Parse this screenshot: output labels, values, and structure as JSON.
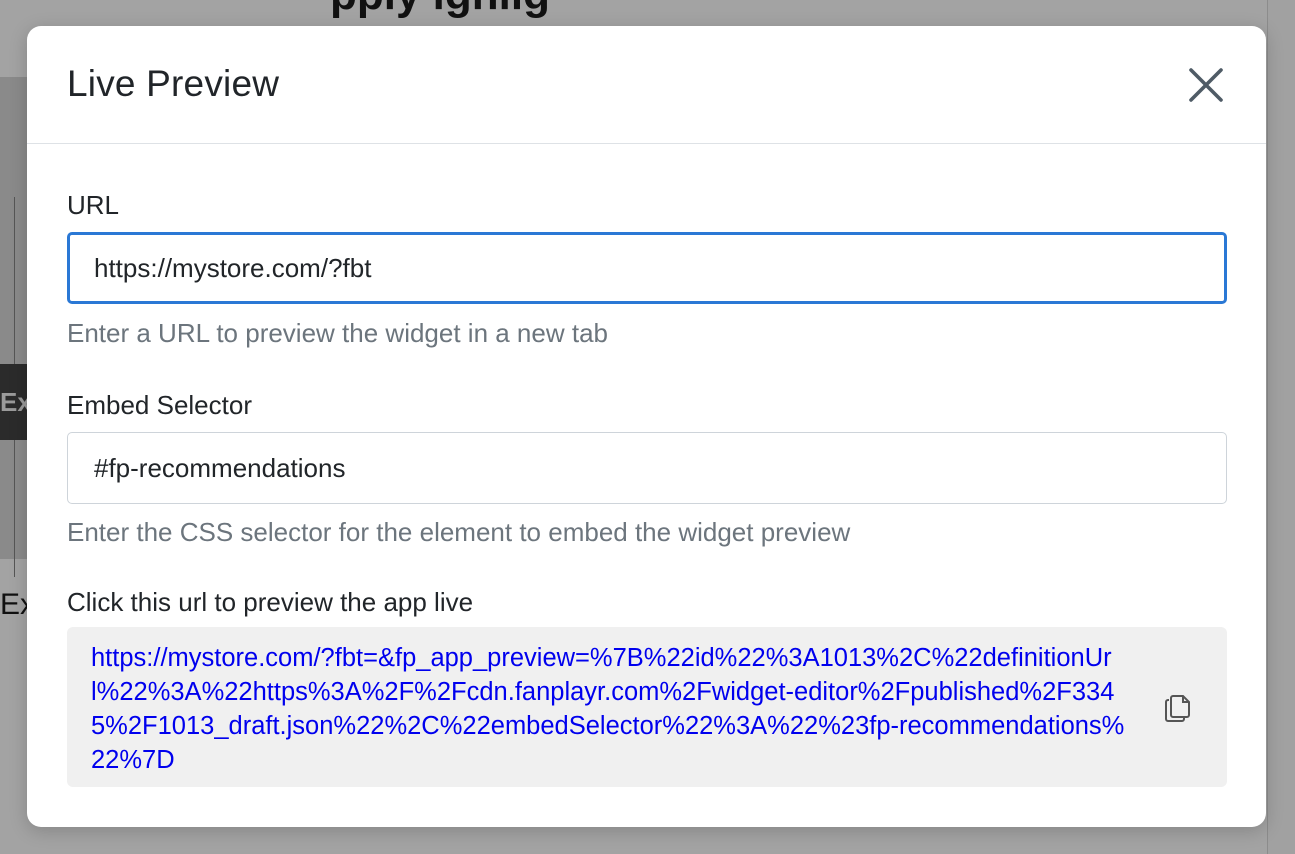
{
  "background": {
    "heading_fragment": "pply ighlig",
    "tag_fragment": "Ex",
    "text_fragment": "Ex"
  },
  "modal": {
    "title": "Live Preview",
    "close_icon": "close-icon",
    "url_field": {
      "label": "URL",
      "value": "https://mystore.com/?fbt",
      "help": "Enter a URL to preview the widget in a new tab"
    },
    "selector_field": {
      "label": "Embed Selector",
      "value": "#fp-recommendations",
      "help": "Enter the CSS selector for the element to embed the widget preview"
    },
    "preview": {
      "label": "Click this url to preview the app live",
      "link": "https://mystore.com/?fbt=&fp_app_preview=%7B%22id%22%3A1013%2C%22definitionUrl%22%3A%22https%3A%2F%2Fcdn.fanplayr.com%2Fwidget-editor%2Fpublished%2F3345%2F1013_draft.json%22%2C%22embedSelector%22%3A%22%23fp-recommendations%22%7D",
      "copy_icon": "copy-icon"
    }
  },
  "colors": {
    "focus_border": "#2a78d5",
    "link": "#0000ee",
    "help_text": "#6c757d",
    "preview_bg": "#f0f0f0"
  }
}
